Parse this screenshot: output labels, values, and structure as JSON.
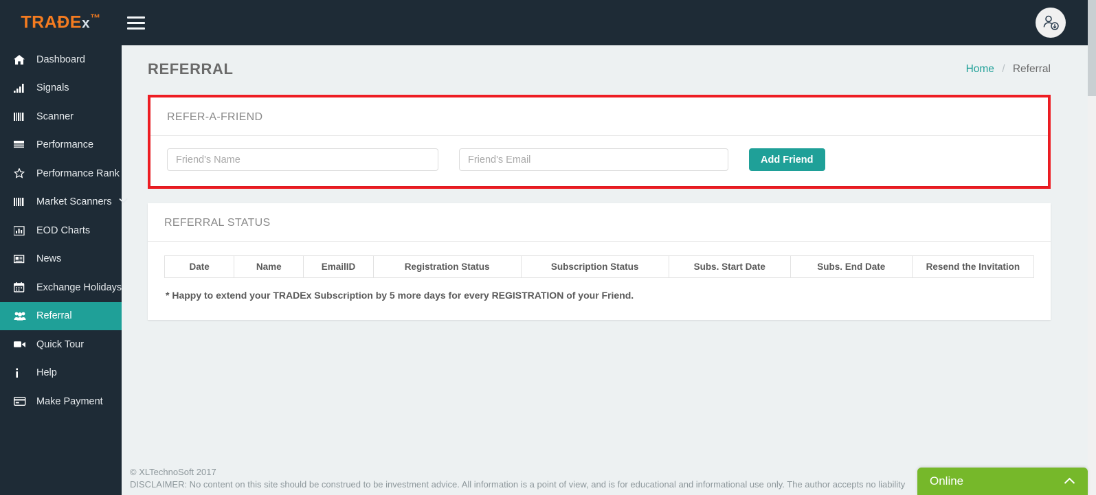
{
  "brand": {
    "name_main": "TRAĐE",
    "name_x": "x",
    "name_tm": "™"
  },
  "topbar": {
    "menu_toggle": "hamburger-menu",
    "avatar_label": "user-account"
  },
  "sidebar": {
    "items": [
      {
        "label": "Dashboard",
        "icon": "home-icon",
        "active": false
      },
      {
        "label": "Signals",
        "icon": "signal-bars-icon",
        "active": false
      },
      {
        "label": "Scanner",
        "icon": "barcode-icon",
        "active": false
      },
      {
        "label": "Performance",
        "icon": "list-icon",
        "active": false
      },
      {
        "label": "Performance Rank",
        "icon": "star-icon",
        "active": false
      },
      {
        "label": "Market Scanners",
        "icon": "barcode-icon",
        "active": false,
        "caret": "˅"
      },
      {
        "label": "EOD Charts",
        "icon": "bar-chart-icon",
        "active": false
      },
      {
        "label": "News",
        "icon": "newspaper-icon",
        "active": false
      },
      {
        "label": "Exchange Holidays",
        "icon": "calendar-icon",
        "active": false
      },
      {
        "label": "Referral",
        "icon": "users-icon",
        "active": true
      },
      {
        "label": "Quick Tour",
        "icon": "video-camera-icon",
        "active": false
      },
      {
        "label": "Help",
        "icon": "info-icon",
        "active": false
      },
      {
        "label": "Make Payment",
        "icon": "credit-card-icon",
        "active": false
      }
    ]
  },
  "page": {
    "title": "REFERRAL",
    "breadcrumb": {
      "home": "Home",
      "separator": "/",
      "current": "Referral"
    }
  },
  "refer_card": {
    "title": "REFER-A-FRIEND",
    "name_placeholder": "Friend's Name",
    "name_value": "",
    "email_placeholder": "Friend's Email",
    "email_value": "",
    "add_button": "Add Friend"
  },
  "status_card": {
    "title": "REFERRAL STATUS",
    "columns": [
      "Date",
      "Name",
      "EmailID",
      "Registration Status",
      "Subscription Status",
      "Subs. Start Date",
      "Subs. End Date",
      "Resend the Invitation"
    ],
    "rows": [],
    "note": "* Happy to extend your TRADEx Subscription by 5 more days for every REGISTRATION of your Friend."
  },
  "footer": {
    "copyright": "© XLTechnoSoft 2017",
    "disclaimer": "DISCLAIMER: No content on this site should be construed to be investment advice. All information is a point of view, and is for educational and informational use only. The author accepts no liability"
  },
  "chat": {
    "status": "Online",
    "chevron": "⌃"
  },
  "colors": {
    "accent_teal": "#1fa098",
    "brand_orange": "#f47b20",
    "sidebar_dark": "#1e2b36",
    "content_bg": "#edf1f2",
    "highlight_red": "#ee1d23",
    "chat_green": "#76b82a"
  }
}
